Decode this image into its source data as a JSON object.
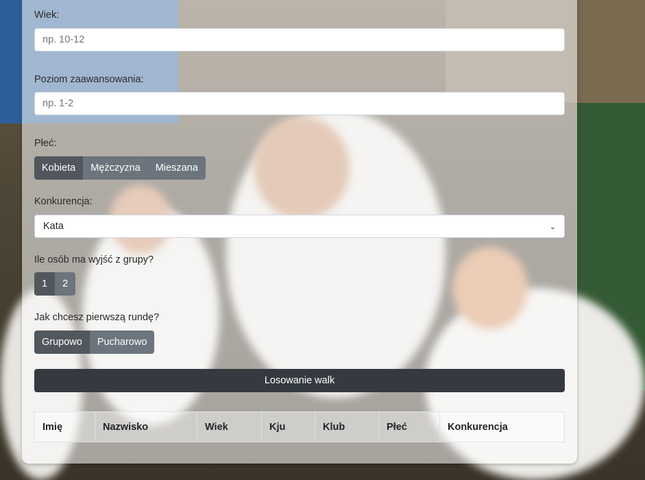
{
  "form": {
    "age": {
      "label": "Wiek:",
      "placeholder": "np. 10-12"
    },
    "level": {
      "label": "Poziom zaawansowania:",
      "placeholder": "np. 1-2"
    },
    "gender": {
      "label": "Płeć:",
      "options": [
        "Kobieta",
        "Mężczyzna",
        "Mieszana"
      ],
      "selected": "Kobieta"
    },
    "competition": {
      "label": "Konkurencja:",
      "selected": "Kata"
    },
    "advance": {
      "label": "Ile osób ma wyjść z grupy?",
      "options": [
        "1",
        "2"
      ],
      "selected": "1"
    },
    "first_round": {
      "label": "Jak chcesz pierwszą rundę?",
      "options": [
        "Grupowo",
        "Pucharowo"
      ],
      "selected": "Grupowo"
    },
    "draw_button": "Losowanie walk"
  },
  "table": {
    "headers": [
      "Imię",
      "Nazwisko",
      "Wiek",
      "Kju",
      "Klub",
      "Płeć",
      "Konkurencja"
    ]
  },
  "colors": {
    "btn_active": "#51575d",
    "btn": "#6c757d",
    "primary": "#343a40"
  }
}
